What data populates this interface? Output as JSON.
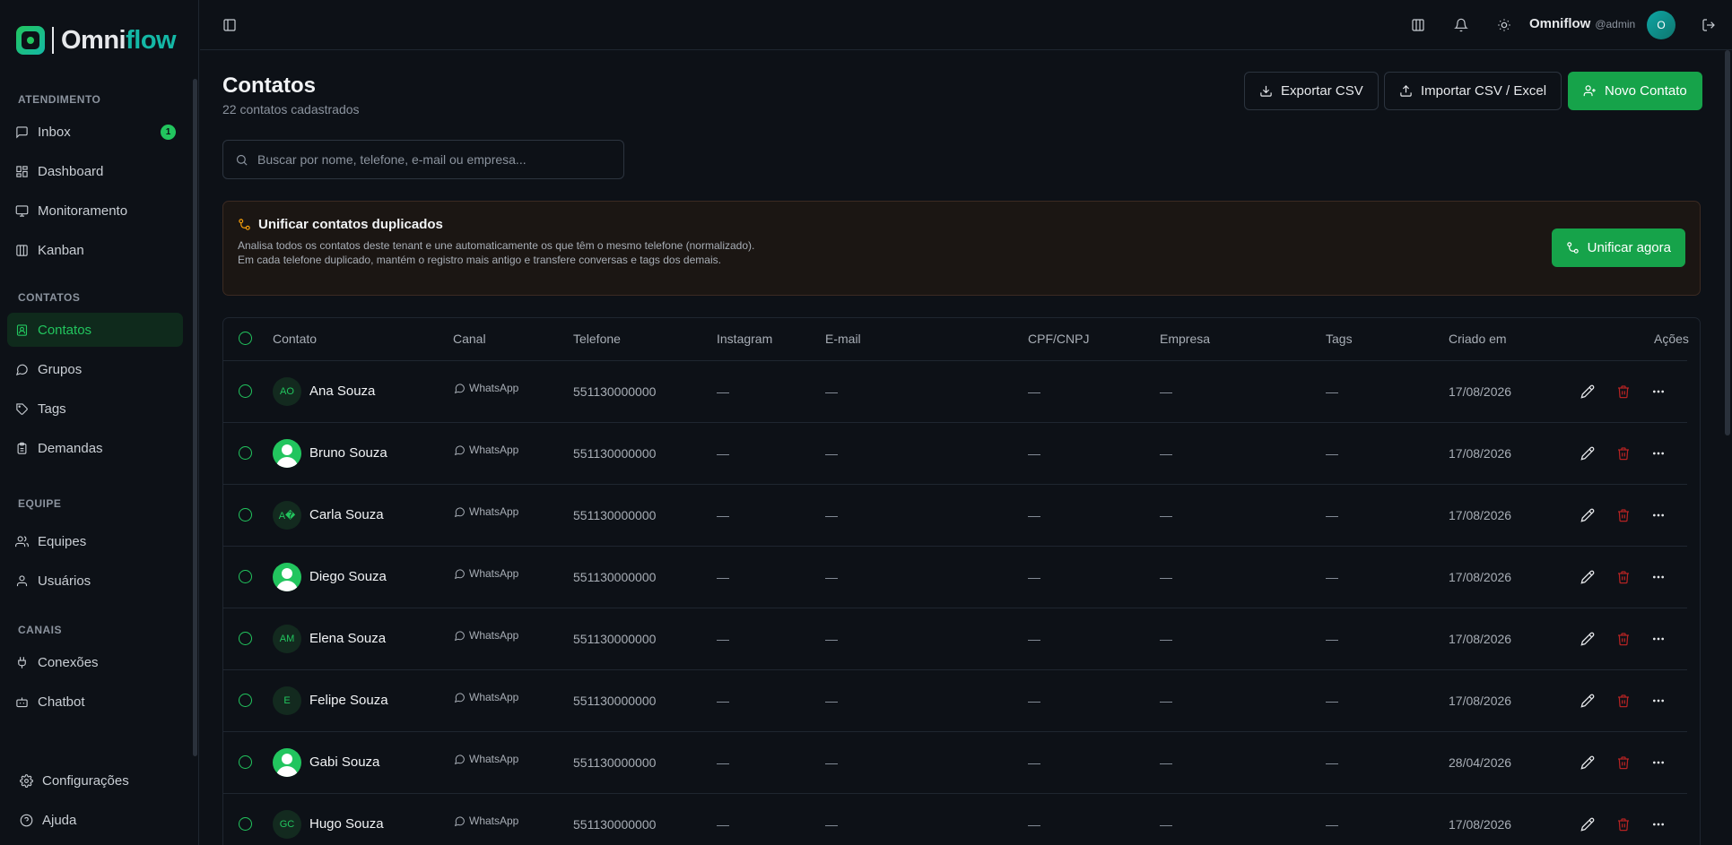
{
  "brand": {
    "name_a": "Omni",
    "name_b": "flow"
  },
  "sidebar": {
    "sections": [
      {
        "title": "ATENDIMENTO",
        "items": [
          {
            "label": "Inbox",
            "icon": "message-square-icon",
            "badge": "1"
          },
          {
            "label": "Dashboard",
            "icon": "layout-grid-icon"
          },
          {
            "label": "Monitoramento",
            "icon": "monitor-icon"
          },
          {
            "label": "Kanban",
            "icon": "columns-icon"
          }
        ]
      },
      {
        "title": "CONTATOS",
        "items": [
          {
            "label": "Contatos",
            "icon": "contact-icon",
            "active": true
          },
          {
            "label": "Grupos",
            "icon": "message-circle-icon"
          },
          {
            "label": "Tags",
            "icon": "tag-icon"
          },
          {
            "label": "Demandas",
            "icon": "clipboard-icon"
          }
        ]
      },
      {
        "title": "EQUIPE",
        "items": [
          {
            "label": "Equipes",
            "icon": "users-icon"
          },
          {
            "label": "Usuários",
            "icon": "user-icon"
          }
        ]
      },
      {
        "title": "CANAIS",
        "items": [
          {
            "label": "Conexões",
            "icon": "plug-icon"
          },
          {
            "label": "Chatbot",
            "icon": "bot-icon"
          }
        ]
      }
    ],
    "footer": [
      {
        "label": "Configurações",
        "icon": "gear-icon"
      },
      {
        "label": "Ajuda",
        "icon": "help-circle-icon"
      }
    ]
  },
  "topbar": {
    "user_name": "Omniflow",
    "user_handle": "@admin",
    "avatar_initial": "O"
  },
  "page": {
    "title": "Contatos",
    "subtitle": "22 contatos cadastrados",
    "export_label": "Exportar CSV",
    "import_label": "Importar CSV / Excel",
    "new_label": "Novo Contato",
    "search_placeholder": "Buscar por nome, telefone, e-mail ou empresa..."
  },
  "merge_banner": {
    "title": "Unificar contatos duplicados",
    "description": "Analisa todos os contatos deste tenant e une automaticamente os que têm o mesmo telefone (normalizado). Em cada telefone duplicado, mantém o registro mais antigo e transfere conversas e tags dos demais.",
    "button": "Unificar agora"
  },
  "table": {
    "columns": [
      "Contato",
      "Canal",
      "Telefone",
      "Instagram",
      "E-mail",
      "CPF/CNPJ",
      "Empresa",
      "Tags",
      "Criado em",
      "Ações"
    ],
    "rows": [
      {
        "initials": "AO",
        "photo": false,
        "name": "Ana Souza",
        "canal": "WhatsApp",
        "phone": "551130000000",
        "instagram": "—",
        "email": "—",
        "cpf": "—",
        "empresa": "—",
        "tags": "—",
        "created": "17/08/2026"
      },
      {
        "initials": "",
        "photo": true,
        "name": "Bruno Souza",
        "canal": "WhatsApp",
        "phone": "551130000000",
        "instagram": "—",
        "email": "—",
        "cpf": "—",
        "empresa": "—",
        "tags": "—",
        "created": "17/08/2026"
      },
      {
        "initials": "A�",
        "photo": false,
        "name": "Carla Souza",
        "canal": "WhatsApp",
        "phone": "551130000000",
        "instagram": "—",
        "email": "—",
        "cpf": "—",
        "empresa": "—",
        "tags": "—",
        "created": "17/08/2026"
      },
      {
        "initials": "",
        "photo": true,
        "name": "Diego Souza",
        "canal": "WhatsApp",
        "phone": "551130000000",
        "instagram": "—",
        "email": "—",
        "cpf": "—",
        "empresa": "—",
        "tags": "—",
        "created": "17/08/2026"
      },
      {
        "initials": "AM",
        "photo": false,
        "name": "Elena Souza",
        "canal": "WhatsApp",
        "phone": "551130000000",
        "instagram": "—",
        "email": "—",
        "cpf": "—",
        "empresa": "—",
        "tags": "—",
        "created": "17/08/2026"
      },
      {
        "initials": "E",
        "photo": false,
        "name": "Felipe Souza",
        "canal": "WhatsApp",
        "phone": "551130000000",
        "instagram": "—",
        "email": "—",
        "cpf": "—",
        "empresa": "—",
        "tags": "—",
        "created": "17/08/2026"
      },
      {
        "initials": "",
        "photo": true,
        "name": "Gabi Souza",
        "canal": "WhatsApp",
        "phone": "551130000000",
        "instagram": "—",
        "email": "—",
        "cpf": "—",
        "empresa": "—",
        "tags": "—",
        "created": "28/04/2026"
      },
      {
        "initials": "GC",
        "photo": false,
        "name": "Hugo Souza",
        "canal": "WhatsApp",
        "phone": "551130000000",
        "instagram": "—",
        "email": "—",
        "cpf": "—",
        "empresa": "—",
        "tags": "—",
        "created": "17/08/2026"
      }
    ]
  },
  "colors": {
    "accent": "#16a34a",
    "background": "#0d1117",
    "danger": "#b42323",
    "warning": "#f59e0b"
  }
}
